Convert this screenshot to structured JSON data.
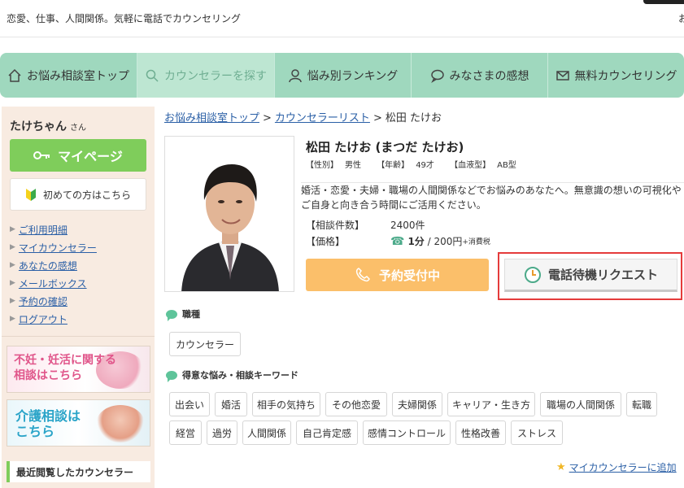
{
  "header": {
    "tagline": "恋愛、仕事、人間関係。気軽に電話でカウンセリング",
    "tagline_cut": "お"
  },
  "nav": {
    "items": [
      {
        "label": "お悩み相談室トップ",
        "icon": "house-icon"
      },
      {
        "label": "カウンセラーを探す",
        "icon": "search-icon"
      },
      {
        "label": "悩み別ランキング",
        "icon": "person-icon"
      },
      {
        "label": "みなさまの感想",
        "icon": "speech-bubble-icon"
      },
      {
        "label": "無料カウンセリング",
        "icon": "mail-icon"
      }
    ]
  },
  "sidebar": {
    "user_name": "たけちゃん",
    "user_suffix": "さん",
    "mypage_label": "マイページ",
    "first_time_label": "初めての方はこちら",
    "links": [
      "ご利用明細",
      "マイカウンセラー",
      "あなたの感想",
      "メールボックス",
      "予約の確認",
      "ログアウト"
    ],
    "banner1": {
      "line1": "不妊・妊活に関する",
      "line2": "相談はこちら"
    },
    "banner2": {
      "line1": "介護相談は",
      "line2": "こちら"
    },
    "recent_title": "最近閲覧したカウンセラー"
  },
  "breadcrumb": {
    "home": "お悩み相談室トップ",
    "list": "カウンセラーリスト",
    "current": "松田 たけお",
    "separator": ">"
  },
  "counselor": {
    "name": "松田 たけお (まつだ たけお)",
    "gender_label": "【性別】",
    "gender": "男性",
    "age_label": "【年齢】",
    "age": "49才",
    "blood_label": "【血液型】",
    "blood": "AB型",
    "desc_line1": "婚活・恋愛・夫婦・職場の人間関係などでお悩みのあなたへ。無意識の想いの可視化や",
    "desc_line2": "ご自身と向き合う時間にご活用ください。",
    "count_label": "【相談件数】",
    "count": "2400件",
    "price_label": "【価格】",
    "price_unit": "1分",
    "price_sep": " / ",
    "price_value": "200円",
    "price_tax": "+消費税"
  },
  "actions": {
    "reserve_label": "予約受付中",
    "standby_label": "電話待機リクエスト"
  },
  "sections": {
    "job_title": "職種",
    "job_tags": [
      "カウンセラー"
    ],
    "keyword_title": "得意な悩み・相談キーワード",
    "keywords_row1": [
      "出会い",
      "婚活",
      "相手の気持ち",
      "その他恋愛",
      "夫婦関係",
      "キャリア・生き方",
      "職場の人間関係",
      "転職"
    ],
    "keywords_row2": [
      "経営",
      "過労",
      "人間関係",
      "自己肯定感",
      "感情コントロール",
      "性格改善",
      "ストレス"
    ]
  },
  "add_favorite_label": "マイカウンセラーに追加",
  "colors": {
    "nav_bg": "#9fd8be",
    "mypage_green": "#7fcd5b",
    "reserve_orange": "#fbbf6a",
    "highlight_red": "#e53b3b",
    "link_blue": "#2a5fa6"
  }
}
